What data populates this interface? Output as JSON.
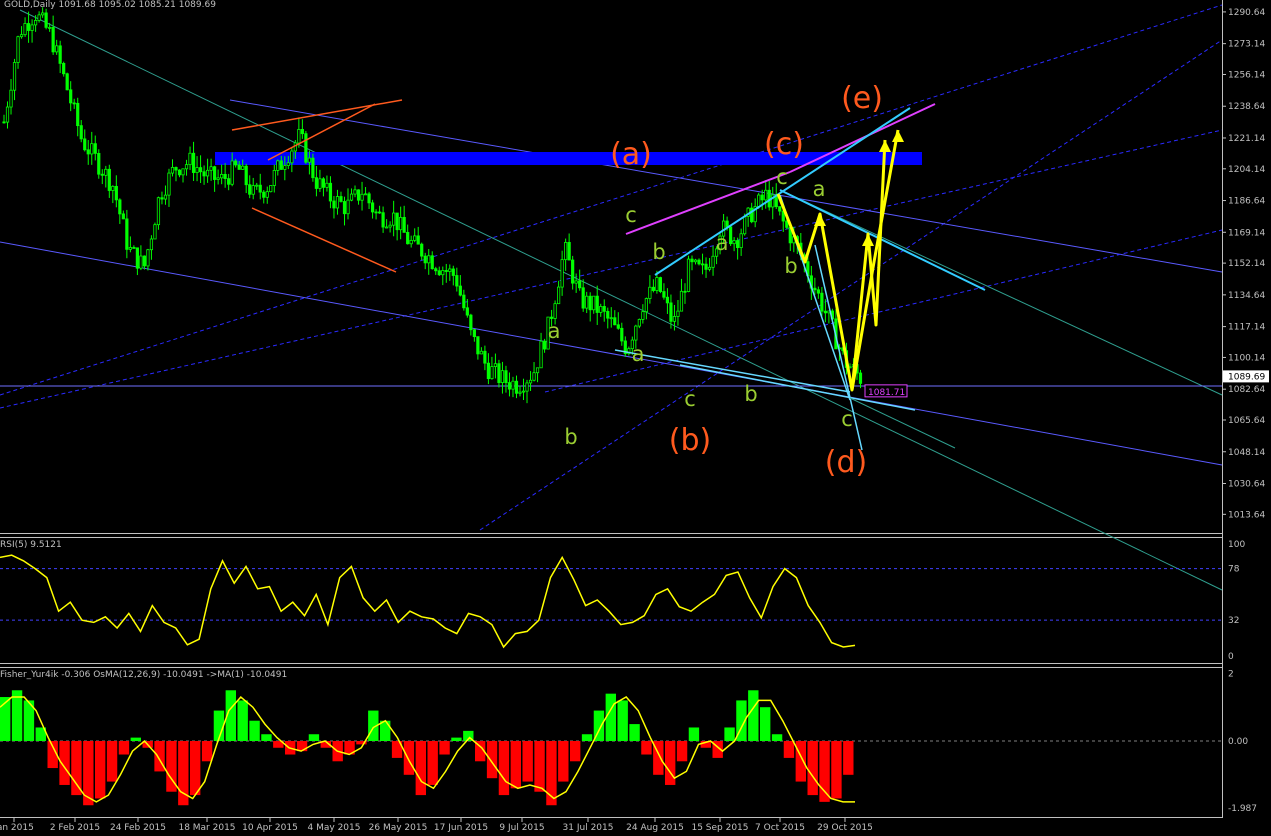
{
  "header": {
    "main": "GOLD,Daily  1091.68 1095.02 1085.21 1089.69",
    "rsi": "RSI(5) 9.5121",
    "osma": "Fisher_Yur4ik -0.306  OsMA(12,26,9) -10.0491  ->MA(1) -10.0491"
  },
  "colors": {
    "background": "#000000",
    "candle": "#00ff00",
    "rsi_line": "#ffff00",
    "hist_pos": "#00ff00",
    "hist_neg": "#ff0000",
    "wave_orange": "#ff5a1e",
    "wave_green": "#9acd32",
    "channel_blue": "#0000ff",
    "magenta": "#e040ff",
    "cyan": "#33ccff",
    "yellow": "#ffff00"
  },
  "chart_data": [
    {
      "type": "candlestick",
      "ylim": [
        1005,
        1295
      ],
      "y_ticks": [
        "1290.64",
        "1273.14",
        "1256.14",
        "1238.64",
        "1221.14",
        "1204.14",
        "1186.64",
        "1169.14",
        "1152.14",
        "1134.64",
        "1117.14",
        "1100.14",
        "1082.64",
        "1065.64",
        "1048.14",
        "1030.64",
        "1013.64"
      ],
      "current_price": "1089.69",
      "price_marker": "1081.71",
      "x_labels": [
        "Jan 2015",
        "2 Feb 2015",
        "24 Feb 2015",
        "18 Mar 2015",
        "10 Apr 2015",
        "4 May 2015",
        "26 May 2015",
        "17 Jun 2015",
        "9 Jul 2015",
        "31 Jul 2015",
        "24 Aug 2015",
        "15 Sep 2015",
        "7 Oct 2015",
        "29 Oct 2015"
      ],
      "close_path": [
        1230,
        1280,
        1290,
        1278,
        1250,
        1220,
        1208,
        1195,
        1160,
        1150,
        1190,
        1205,
        1208,
        1200,
        1198,
        1205,
        1190,
        1195,
        1210,
        1222,
        1198,
        1188,
        1183,
        1192,
        1178,
        1178,
        1164,
        1158,
        1150,
        1145,
        1112,
        1095,
        1088,
        1085,
        1092,
        1118,
        1160,
        1132,
        1128,
        1119,
        1105,
        1130,
        1140,
        1118,
        1150,
        1147,
        1172,
        1165,
        1180,
        1190,
        1175,
        1160,
        1140,
        1120,
        1098,
        1089
      ],
      "wave_labels": {
        "orange": [
          "(a)",
          "(b)",
          "(c)",
          "(d)",
          "(e)"
        ],
        "green": [
          "a",
          "b",
          "c",
          "a",
          "b",
          "c",
          "a",
          "b",
          "c",
          "a",
          "b",
          "c"
        ]
      }
    },
    {
      "type": "line",
      "name": "RSI(5)",
      "ylim": [
        0,
        100
      ],
      "y_ticks": [
        "100",
        "78",
        "32",
        "0"
      ],
      "values": [
        88,
        90,
        85,
        78,
        70,
        40,
        48,
        32,
        30,
        35,
        25,
        38,
        22,
        45,
        30,
        25,
        10,
        15,
        60,
        85,
        65,
        80,
        60,
        62,
        40,
        48,
        36,
        55,
        28,
        70,
        80,
        52,
        40,
        50,
        30,
        40,
        35,
        33,
        25,
        20,
        38,
        35,
        28,
        8,
        20,
        22,
        32,
        70,
        88,
        68,
        45,
        50,
        40,
        28,
        30,
        36,
        55,
        60,
        44,
        40,
        48,
        55,
        72,
        75,
        52,
        34,
        62,
        78,
        70,
        45,
        30,
        12,
        8,
        9.5
      ]
    },
    {
      "type": "bar",
      "name": "OsMA(12,26,9)",
      "ylim": [
        -2.1,
        2.1
      ],
      "y_ticks": [
        "2",
        "0.00",
        "-1.987"
      ],
      "values": [
        1.3,
        1.5,
        1.2,
        0.4,
        -0.8,
        -1.3,
        -1.6,
        -1.9,
        -1.7,
        -1.2,
        -0.4,
        0.1,
        -0.2,
        -0.9,
        -1.5,
        -1.9,
        -1.6,
        -0.6,
        0.9,
        1.5,
        1.2,
        0.6,
        0.2,
        -0.2,
        -0.4,
        -0.3,
        0.2,
        -0.2,
        -0.6,
        -0.4,
        -0.1,
        0.9,
        0.6,
        -0.5,
        -1.0,
        -1.6,
        -1.3,
        -0.4,
        0.1,
        0.3,
        -0.6,
        -1.1,
        -1.6,
        -1.4,
        -1.2,
        -1.5,
        -1.9,
        -1.2,
        -0.6,
        0.2,
        0.9,
        1.4,
        1.2,
        0.5,
        -0.4,
        -1.0,
        -1.3,
        -0.6,
        0.4,
        -0.2,
        -0.5,
        0.4,
        1.2,
        1.5,
        1.0,
        0.2,
        -0.5,
        -1.2,
        -1.6,
        -1.8,
        -1.7,
        -1.0
      ],
      "signal": [
        1.0,
        1.3,
        1.3,
        0.9,
        0.1,
        -0.6,
        -1.1,
        -1.6,
        -1.8,
        -1.6,
        -1.0,
        -0.3,
        0.0,
        -0.4,
        -1.0,
        -1.5,
        -1.7,
        -1.2,
        -0.1,
        0.9,
        1.3,
        1.0,
        0.5,
        0.1,
        -0.2,
        -0.3,
        -0.1,
        0.0,
        -0.3,
        -0.4,
        -0.2,
        0.4,
        0.6,
        0.1,
        -0.6,
        -1.2,
        -1.4,
        -0.9,
        -0.3,
        0.1,
        -0.2,
        -0.7,
        -1.2,
        -1.4,
        -1.3,
        -1.4,
        -1.7,
        -1.5,
        -0.9,
        -0.2,
        0.5,
        1.1,
        1.3,
        0.9,
        0.1,
        -0.6,
        -1.1,
        -0.9,
        -0.1,
        0.0,
        -0.3,
        0.0,
        0.7,
        1.2,
        1.2,
        0.6,
        -0.1,
        -0.8,
        -1.3,
        -1.7,
        -1.8,
        -1.8
      ]
    }
  ]
}
